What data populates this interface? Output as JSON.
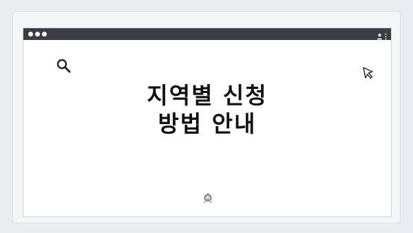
{
  "headline": {
    "line1": "지역별 신청",
    "line2": "방법 안내"
  },
  "icons": {
    "search": "search-icon",
    "cursor": "cursor-arrow-icon",
    "smile": "smile-face-icon",
    "user": "user-icon",
    "menu": "kebab-menu-icon"
  },
  "colors": {
    "background": "#e9edf1",
    "titlebar": "#3a3d42",
    "window": "#ffffff",
    "text": "#111111"
  }
}
